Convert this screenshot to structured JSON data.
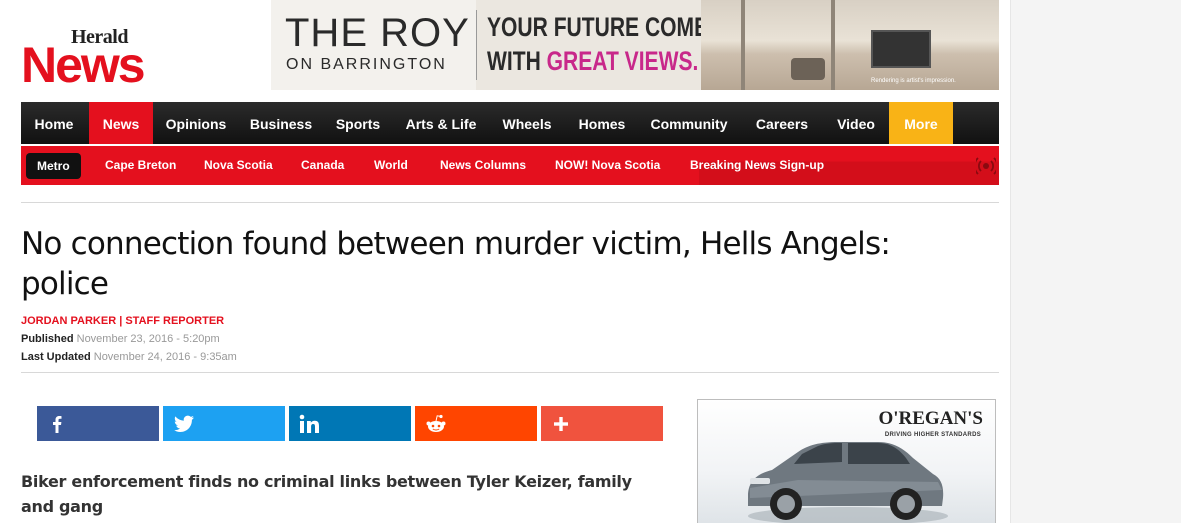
{
  "logo": {
    "top": "Herald",
    "main": "News"
  },
  "banner": {
    "title": "THE ROY",
    "subtitle": "ON BARRINGTON",
    "tagline_1": "YOUR FUTURE COMES",
    "tagline_2_prefix": "WITH ",
    "tagline_2_highlight": "GREAT VIEWS.",
    "fine_print": "Rendering is artist's impression."
  },
  "main_nav": {
    "items": [
      {
        "label": "Home"
      },
      {
        "label": "News",
        "active": true
      },
      {
        "label": "Opinions"
      },
      {
        "label": "Business"
      },
      {
        "label": "Sports"
      },
      {
        "label": "Arts & Life"
      },
      {
        "label": "Wheels"
      },
      {
        "label": "Homes"
      },
      {
        "label": "Community"
      },
      {
        "label": "Careers"
      },
      {
        "label": "Video"
      },
      {
        "label": "More"
      }
    ]
  },
  "sub_nav": {
    "items": [
      {
        "label": "Metro",
        "active": true
      },
      {
        "label": "Cape Breton"
      },
      {
        "label": "Nova Scotia"
      },
      {
        "label": "Canada"
      },
      {
        "label": "World"
      },
      {
        "label": "News Columns"
      },
      {
        "label": "NOW! Nova Scotia"
      },
      {
        "label": "Breaking News Sign-up"
      }
    ],
    "alert_icon": "broadcast-alert-icon"
  },
  "article": {
    "headline": "No connection found between murder victim, Hells Angels: police",
    "byline": "JORDAN PARKER | STAFF REPORTER",
    "published_label": "Published",
    "published_value": "November 23, 2016 - 5:20pm",
    "updated_label": "Last Updated",
    "updated_value": "November 24, 2016 - 9:35am",
    "deck": "Biker enforcement finds no criminal links between Tyler Keizer, family and gang"
  },
  "share": {
    "buttons": [
      {
        "name": "facebook",
        "icon": "facebook-icon",
        "color": "#3b5998"
      },
      {
        "name": "twitter",
        "icon": "twitter-icon",
        "color": "#1da1f2"
      },
      {
        "name": "linkedin",
        "icon": "linkedin-icon",
        "color": "#0077b5"
      },
      {
        "name": "reddit",
        "icon": "reddit-icon",
        "color": "#ff4500"
      },
      {
        "name": "more",
        "icon": "plus-icon",
        "color": "#f0533e"
      }
    ]
  },
  "sidebar_ad": {
    "brand": "O'REGAN'S",
    "tagline": "DRIVING HIGHER STANDARDS"
  },
  "colors": {
    "brand_red": "#e4101e",
    "more_orange": "#f9b316",
    "nav_dark": "#1a1a1a",
    "banner_highlight": "#c8288a"
  }
}
